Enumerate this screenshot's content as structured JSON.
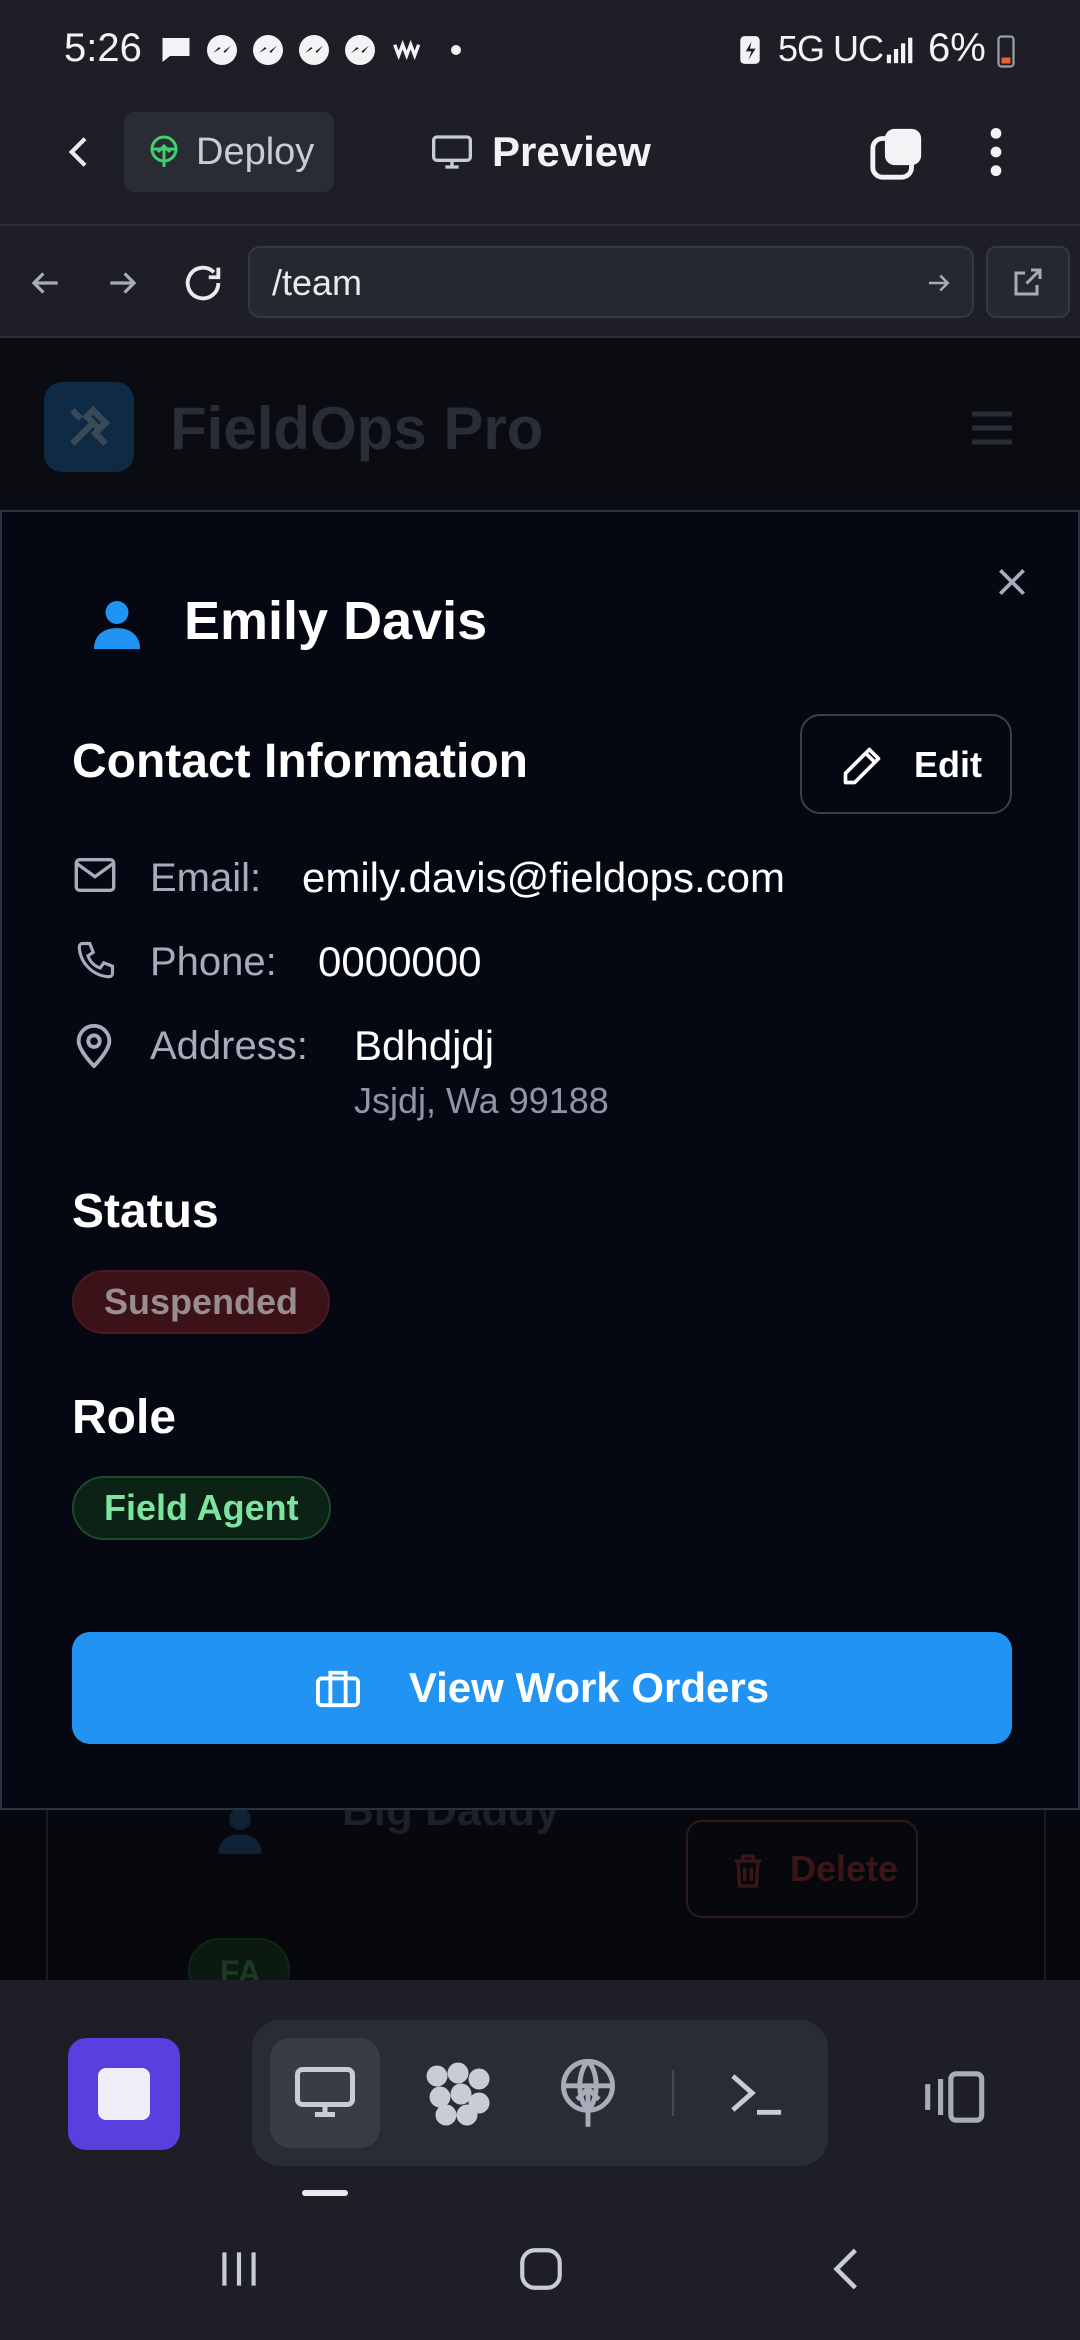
{
  "status_bar": {
    "time": "5:26",
    "network": "5G UC",
    "battery": "6%"
  },
  "toolbar": {
    "deploy_label": "Deploy",
    "preview_label": "Preview"
  },
  "url_bar": {
    "url": "/team"
  },
  "app": {
    "title": "FieldOps Pro",
    "background_member_name": "Big Daddy",
    "background_delete_label": "Delete",
    "background_role_badge": "FA"
  },
  "modal": {
    "title": "Emily Davis",
    "contact_heading": "Contact Information",
    "edit_label": "Edit",
    "email_label": "Email:",
    "email_value": "emily.davis@fieldops.com",
    "phone_label": "Phone:",
    "phone_value": "0000000",
    "address_label": "Address:",
    "address_line1": "Bdhdjdj",
    "address_line2": "Jsjdj, Wa 99188",
    "status_heading": "Status",
    "status_value": "Suspended",
    "role_heading": "Role",
    "role_value": "Field Agent",
    "work_orders_label": "View Work Orders"
  },
  "colors": {
    "accent_blue": "#2194f3",
    "stop_purple": "#5a3ee0",
    "suspended_bg": "#3a1217",
    "field_agent_text": "#7fe3a0"
  }
}
